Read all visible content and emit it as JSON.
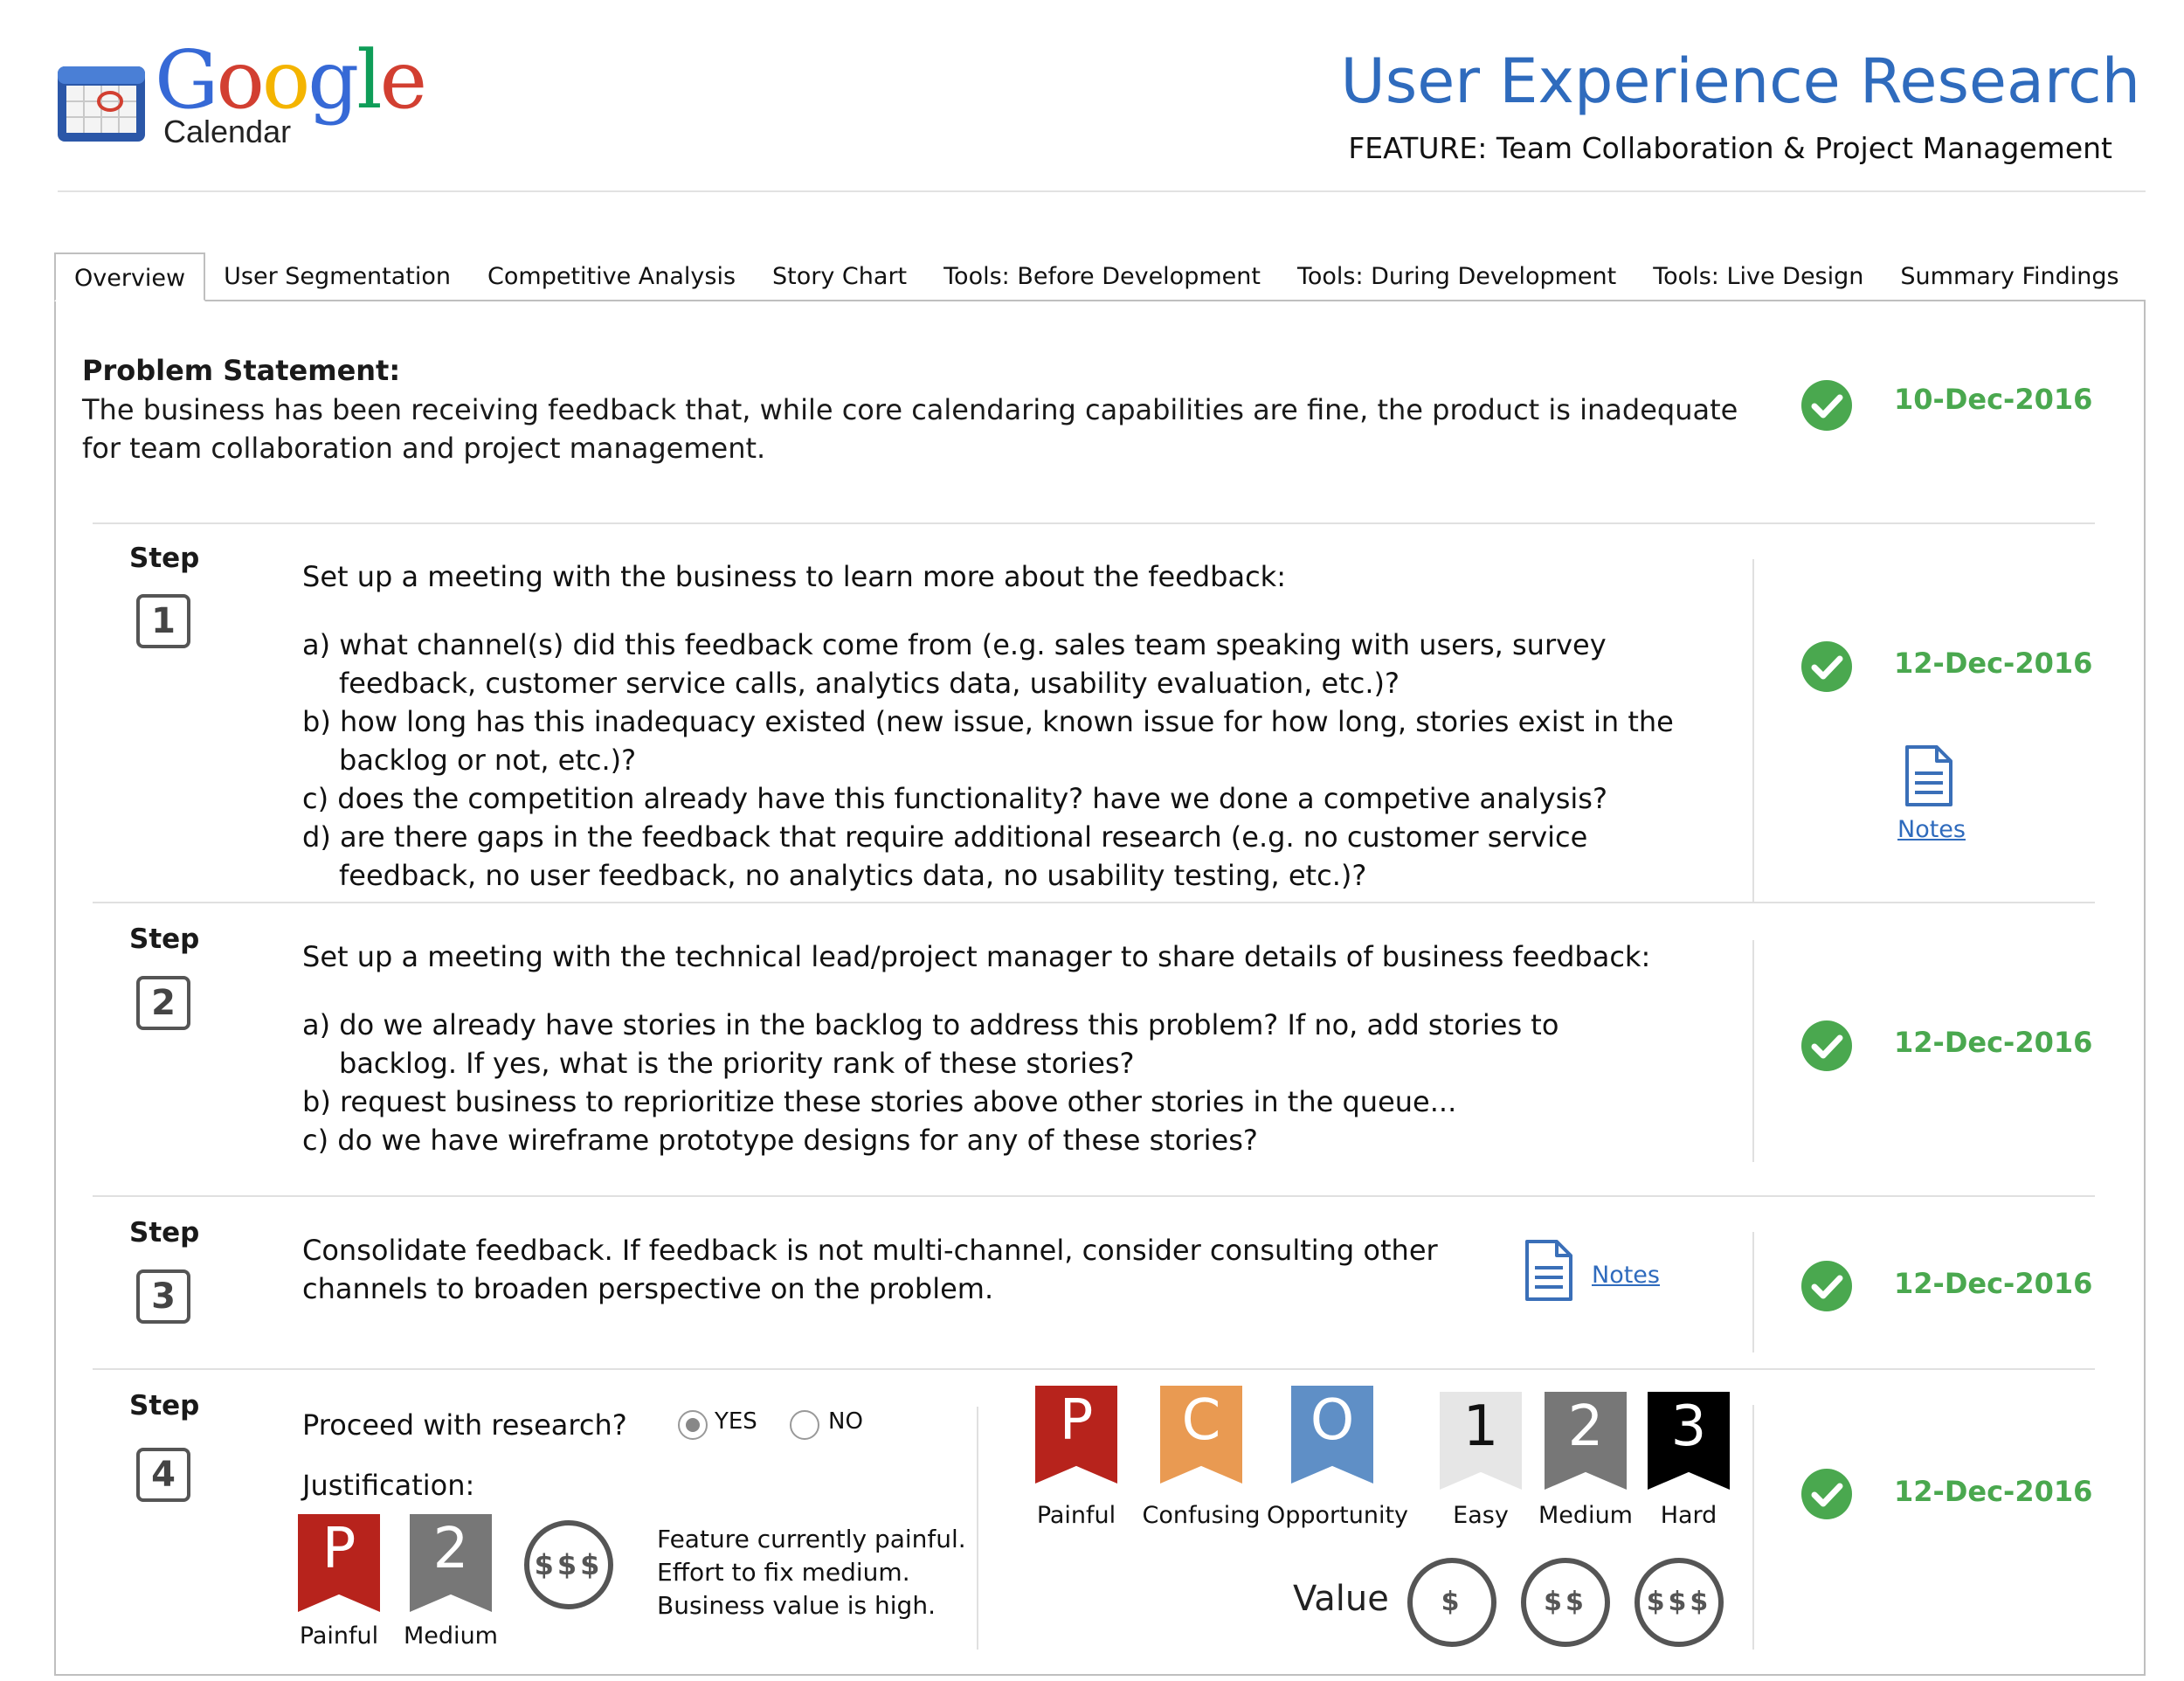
{
  "header": {
    "logo_word": [
      "G",
      "o",
      "o",
      "g",
      "l",
      "e"
    ],
    "logo_sub": "Calendar",
    "title": "User Experience Research",
    "subtitle": "FEATURE: Team Collaboration & Project Management"
  },
  "tabs": [
    {
      "label": "Overview",
      "active": true
    },
    {
      "label": "User Segmentation",
      "active": false
    },
    {
      "label": "Competitive Analysis",
      "active": false
    },
    {
      "label": "Story Chart",
      "active": false
    },
    {
      "label": "Tools: Before Development",
      "active": false
    },
    {
      "label": "Tools: During Development",
      "active": false
    },
    {
      "label": "Tools: Live Design",
      "active": false
    },
    {
      "label": "Summary Findings",
      "active": false
    }
  ],
  "problem": {
    "heading": "Problem Statement:",
    "text": "The business has been receiving feedback that, while core calendaring capabilities are fine, the product is inadequate for team collaboration and project management.",
    "date": "10-Dec-2016"
  },
  "step_label": "Step",
  "notes_label": "Notes",
  "steps": [
    {
      "number": "1",
      "intro": "Set up a meeting with the business to learn more about the feedback:",
      "items": [
        "a) what channel(s) did this feedback come from (e.g. sales team speaking with users, survey feedback, customer service calls, analytics data, usability evaluation, etc.)?",
        "b) how long has this inadequacy existed (new issue, known issue for how long, stories exist in the backlog or not, etc.)?",
        "c) does the competition already have this functionality? have we done a competive analysis?",
        "d) are there gaps in the feedback that require additional research (e.g. no customer service feedback,  no user feedback, no analytics data, no usability testing, etc.)?"
      ],
      "date": "12-Dec-2016"
    },
    {
      "number": "2",
      "intro": "Set up a meeting with the technical lead/project manager to share details of business feedback:",
      "items": [
        "a) do we already have stories in the backlog to address this problem? If no, add stories to backlog. If yes, what is the priority rank of these stories?",
        "b) request business to reprioritize these stories above other stories in the queue...",
        "c) do we have wireframe prototype designs for any of these stories?"
      ],
      "date": "12-Dec-2016"
    },
    {
      "number": "3",
      "intro": "Consolidate feedback. If feedback is not multi-channel, consider consulting other channels to broaden perspective on the problem.",
      "items": [],
      "date": "12-Dec-2016"
    },
    {
      "number": "4",
      "date": "12-Dec-2016"
    }
  ],
  "step4": {
    "question": "Proceed with research?",
    "options": [
      {
        "label": "YES",
        "checked": true
      },
      {
        "label": "NO",
        "checked": false
      }
    ],
    "justification_label": "Justification:",
    "justification_badges": [
      {
        "glyph": "P",
        "label": "Painful",
        "color": "#b7231c"
      },
      {
        "glyph": "2",
        "label": "Medium",
        "color": "#777777"
      }
    ],
    "justification_coin": "$$$",
    "justification_lines": [
      "Feature currently painful.",
      "Effort to fix medium.",
      "Business value is high."
    ],
    "legend_type": [
      {
        "glyph": "P",
        "label": "Painful",
        "color": "#b7231c"
      },
      {
        "glyph": "C",
        "label": "Confusing",
        "color": "#e99a52"
      },
      {
        "glyph": "O",
        "label": "Opportunity",
        "color": "#5f8fc6"
      }
    ],
    "legend_effort": [
      {
        "glyph": "1",
        "label": "Easy",
        "color": "#e6e6e6",
        "text_color": "#111111"
      },
      {
        "glyph": "2",
        "label": "Medium",
        "color": "#777777",
        "text_color": "#ffffff"
      },
      {
        "glyph": "3",
        "label": "Hard",
        "color": "#000000",
        "text_color": "#ffffff"
      }
    ],
    "value_label": "Value",
    "value_coins": [
      "$",
      "$$",
      "$$$"
    ]
  },
  "colors": {
    "title_blue": "#2f6bbd",
    "done_green": "#4aa84f"
  },
  "icons": {
    "check": "check-circle-icon",
    "notes": "document-icon",
    "logo": "calendar-icon"
  }
}
